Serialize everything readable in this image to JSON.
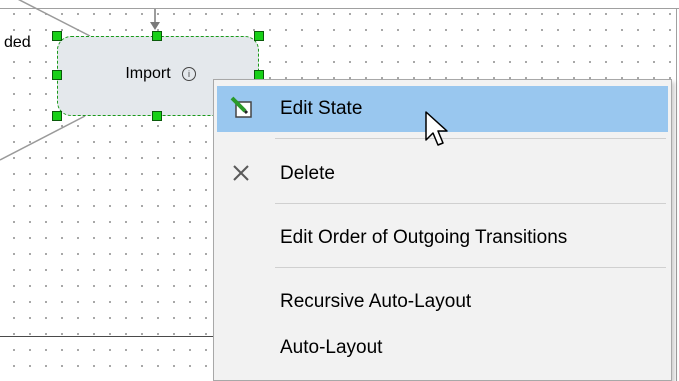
{
  "canvas": {
    "partial_state_label": "ded"
  },
  "state": {
    "name": "Import",
    "info_glyph": "i",
    "selection_color": "#18d018"
  },
  "context_menu": {
    "items": [
      {
        "label": "Edit State",
        "icon": "edit-pencil-icon",
        "highlighted": true
      },
      {
        "label": "Delete",
        "icon": "close-x-icon",
        "highlighted": false
      },
      {
        "label": "Edit Order of Outgoing Transitions",
        "icon": "",
        "highlighted": false
      },
      {
        "label": "Recursive Auto-Layout",
        "icon": "",
        "highlighted": false
      },
      {
        "label": "Auto-Layout",
        "icon": "",
        "highlighted": false
      }
    ],
    "highlight_color": "#99c7ef"
  }
}
